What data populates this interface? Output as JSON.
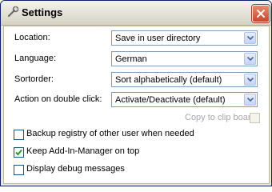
{
  "window": {
    "title": "Settings",
    "title_icon": "settings-wrench-icon",
    "close_icon": "close-icon"
  },
  "form": {
    "location": {
      "label": "Location:",
      "value": "Save in user directory"
    },
    "language": {
      "label": "Language:",
      "value": "German"
    },
    "sortorder": {
      "label": "Sortorder:",
      "value": "Sort alphabetically (default)"
    },
    "double_click": {
      "label": "Action on double click:",
      "value": "Activate/Deactivate (default)"
    },
    "copy_to_clipboard": {
      "label": "Copy to clip board",
      "checked": false,
      "enabled": false
    }
  },
  "options": [
    {
      "label": "Backup registry of other user when needed",
      "checked": false
    },
    {
      "label": "Keep Add-In-Manager on top",
      "checked": true
    },
    {
      "label": "Display debug messages",
      "checked": false
    }
  ],
  "colors": {
    "window_border": "#0a246a",
    "close_button": "#c9452c",
    "check_mark": "#21a121",
    "disabled_text": "#a7a6aa"
  }
}
